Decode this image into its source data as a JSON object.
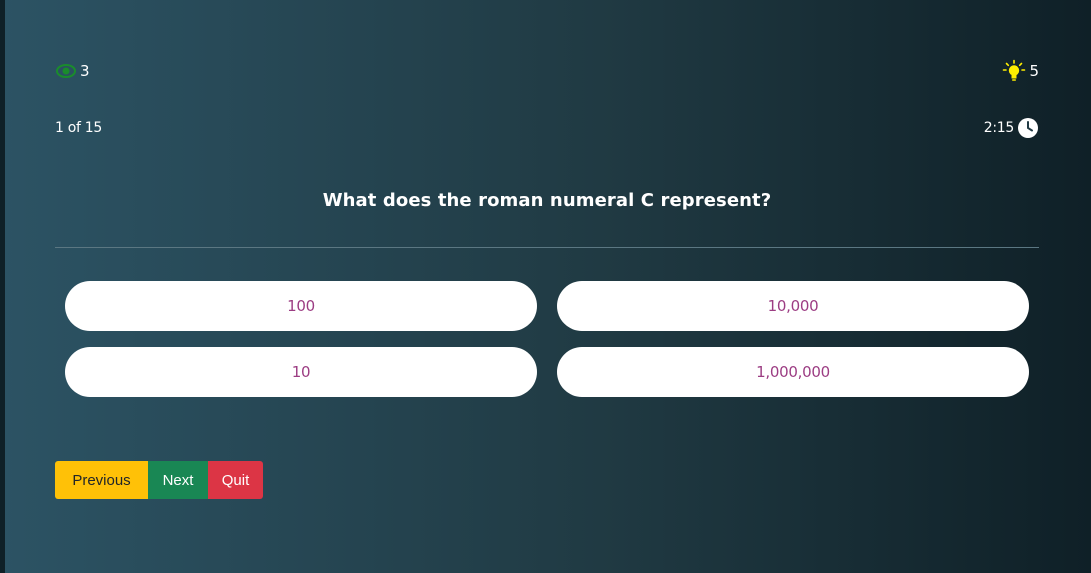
{
  "stats": {
    "lifelines_count": "3",
    "hints_count": "5"
  },
  "progress": {
    "label": "1 of 15"
  },
  "timer": {
    "value": "2:15"
  },
  "question": {
    "text": "What does the roman numeral C represent?"
  },
  "options": [
    {
      "label": "100"
    },
    {
      "label": "10,000"
    },
    {
      "label": "10"
    },
    {
      "label": "1,000,000"
    }
  ],
  "buttons": {
    "previous_label": "Previous",
    "next_label": "Next",
    "quit_label": "Quit"
  },
  "colors": {
    "option_text": "#9c3d83",
    "previous": "#ffc107",
    "next": "#198754",
    "quit": "#dc3545",
    "lifeline_icon": "#1a8c2c",
    "hint_icon": "#ffee00"
  },
  "icons": {
    "lifeline": "lifeline-icon",
    "hint": "lightbulb-icon",
    "timer": "clock-icon"
  }
}
